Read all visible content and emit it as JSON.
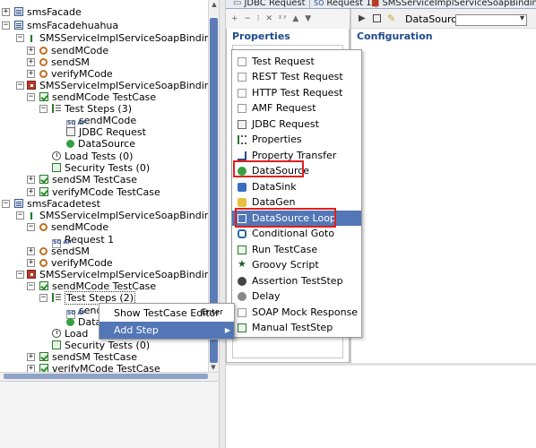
{
  "tree": {
    "items": [
      {
        "label": "smsFacade",
        "icon": "project-icon"
      },
      {
        "label": "smsFacadehuahua",
        "icon": "project-icon"
      },
      {
        "label": "SMSServiceImplServiceSoapBinding",
        "icon": "interface-icon"
      },
      {
        "label": "sendMCode",
        "icon": "operation-icon"
      },
      {
        "label": "sendSM",
        "icon": "operation-icon"
      },
      {
        "label": "verifyMCode",
        "icon": "operation-icon"
      },
      {
        "label": "SMSServiceImplServiceSoapBinding TestSuit",
        "icon": "testsuite-icon"
      },
      {
        "label": "sendMCode TestCase",
        "icon": "testcase-icon"
      },
      {
        "label": "Test Steps (3)",
        "icon": "teststeps-icon"
      },
      {
        "label": "sendMCode",
        "icon": "soap-request-icon"
      },
      {
        "label": "JDBC Request",
        "icon": "jdbc-icon"
      },
      {
        "label": "DataSource",
        "icon": "datasource-icon"
      },
      {
        "label": "Load Tests (0)",
        "icon": "loadtest-icon"
      },
      {
        "label": "Security Tests (0)",
        "icon": "securitytest-icon"
      },
      {
        "label": "sendSM TestCase",
        "icon": "testcase-icon"
      },
      {
        "label": "verifyMCode TestCase",
        "icon": "testcase-icon"
      },
      {
        "label": "smsFacadetest",
        "icon": "project-icon"
      },
      {
        "label": "SMSServiceImplServiceSoapBinding",
        "icon": "interface-icon"
      },
      {
        "label": "sendMCode",
        "icon": "operation-icon"
      },
      {
        "label": "Request 1",
        "icon": "soap-request-icon"
      },
      {
        "label": "sendSM",
        "icon": "operation-icon"
      },
      {
        "label": "verifyMCode",
        "icon": "operation-icon"
      },
      {
        "label": "SMSServiceImplServiceSoapBinding TestSuit",
        "icon": "testsuite-icon"
      },
      {
        "label": "sendMCode TestCase",
        "icon": "testcase-icon"
      },
      {
        "label": "Test Steps (2)",
        "icon": "teststeps-icon"
      },
      {
        "label": "send",
        "icon": "soap-request-icon"
      },
      {
        "label": "Data",
        "icon": "datasource-icon"
      },
      {
        "label": "Load",
        "icon": "loadtest-icon"
      },
      {
        "label": "Security Tests (0)",
        "icon": "securitytest-icon"
      },
      {
        "label": "sendSM TestCase",
        "icon": "testcase-icon"
      },
      {
        "label": "verifyMCode TestCase",
        "icon": "testcase-icon"
      }
    ]
  },
  "tabs": [
    {
      "label": "JDBC Request"
    },
    {
      "label": "Request 1"
    },
    {
      "label": "SMSServiceImplServiceSoapBinding Tes"
    }
  ],
  "left_panel": {
    "title": "Properties",
    "toolbar": "+ − ⁝ ✕ ᵡʸ ▲ ▼"
  },
  "right_panel": {
    "title": "Configuration",
    "datasource_label": "DataSource:",
    "datasource_value": ""
  },
  "context_menu": {
    "items": [
      {
        "label": "Show TestCase Editor",
        "accel": "Enter"
      },
      {
        "label": "Add Step",
        "submenu": "▶"
      }
    ]
  },
  "add_step_menu": {
    "items": [
      {
        "label": "Test Request",
        "icon": "test-request-icon"
      },
      {
        "label": "REST Test Request",
        "icon": "rest-request-icon"
      },
      {
        "label": "HTTP Test Request",
        "icon": "http-request-icon"
      },
      {
        "label": "AMF Request",
        "icon": "amf-request-icon"
      },
      {
        "label": "JDBC Request",
        "icon": "jdbc-request-icon"
      },
      {
        "label": "Properties",
        "icon": "properties-icon"
      },
      {
        "label": "Property Transfer",
        "icon": "property-transfer-icon"
      },
      {
        "label": "DataSource",
        "icon": "datasource-icon"
      },
      {
        "label": "DataSink",
        "icon": "datasink-icon"
      },
      {
        "label": "DataGen",
        "icon": "datagen-icon"
      },
      {
        "label": "DataSource Loop",
        "icon": "datasource-loop-icon"
      },
      {
        "label": "Conditional Goto",
        "icon": "conditional-goto-icon"
      },
      {
        "label": "Run TestCase",
        "icon": "run-testcase-icon"
      },
      {
        "label": "Groovy Script",
        "icon": "groovy-script-icon"
      },
      {
        "label": "Assertion TestStep",
        "icon": "assertion-teststep-icon"
      },
      {
        "label": "Delay",
        "icon": "delay-icon"
      },
      {
        "label": "SOAP Mock Response",
        "icon": "soap-mock-icon"
      },
      {
        "label": "Manual TestStep",
        "icon": "manual-teststep-icon"
      }
    ],
    "selected": "DataSource Loop",
    "highlighted": [
      "DataSource",
      "DataSource Loop"
    ]
  },
  "colors": {
    "selection": "#5377b6",
    "highlight_box": "#e02020",
    "title": "#1f4a8a"
  }
}
